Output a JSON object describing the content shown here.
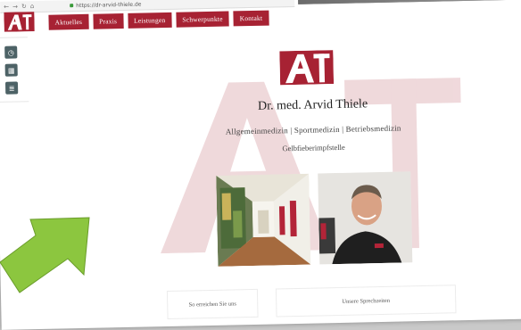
{
  "browser": {
    "nav_icons": [
      "back-icon",
      "forward-icon",
      "reload-icon",
      "home-icon"
    ],
    "url": "https://dr-arvid-thiele.de"
  },
  "site": {
    "logo_text": "AT",
    "nav": [
      "Aktuelles",
      "Praxis",
      "Leistungen",
      "Schwerpunkte",
      "Kontakt"
    ],
    "doctor_name": "Dr. med. Arvid Thiele",
    "specialties": "Allgemeinmedizin | Sportmedizin | Betriebsmedizin",
    "extra": "Gelbfieberimpfstelle",
    "footer": {
      "reach_label": "So erreichen Sie uns",
      "hours_label": "Unsere Sprechzeiten"
    }
  },
  "toolbar": {
    "icons": [
      "clock-icon",
      "calendar-icon",
      "document-icon"
    ]
  },
  "colors": {
    "brand_red": "#a72233",
    "arrow_green": "#8cc63f"
  }
}
